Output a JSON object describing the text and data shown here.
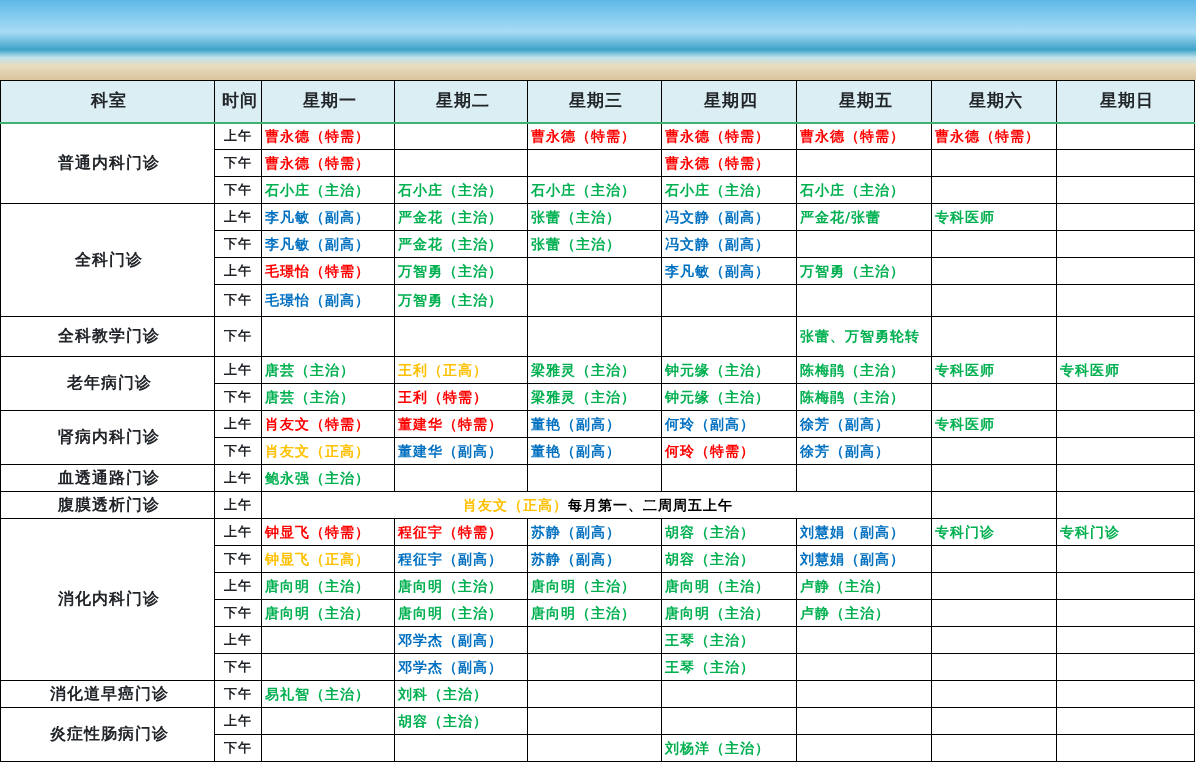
{
  "header": {
    "department": "科室",
    "time": "时间",
    "days": [
      "星期一",
      "星期二",
      "星期三",
      "星期四",
      "星期五",
      "星期六",
      "星期日"
    ]
  },
  "departments": [
    {
      "name": "普通内科门诊",
      "slots": [
        {
          "time": "上午",
          "cells": [
            {
              "text": "曹永德（特需）",
              "color": "#ff0000"
            },
            null,
            {
              "text": "曹永德（特需）",
              "color": "#ff0000"
            },
            {
              "text": "曹永德（特需）",
              "color": "#ff0000"
            },
            {
              "text": "曹永德（特需）",
              "color": "#ff0000"
            },
            {
              "text": "曹永德（特需）",
              "color": "#ff0000"
            },
            null
          ]
        },
        {
          "time": "下午",
          "cells": [
            {
              "text": "曹永德（特需）",
              "color": "#ff0000"
            },
            null,
            null,
            {
              "text": "曹永德（特需）",
              "color": "#ff0000"
            },
            null,
            null,
            null
          ]
        },
        {
          "time": "下午",
          "cells": [
            {
              "text": "石小庄（主治）",
              "color": "#00b050"
            },
            {
              "text": "石小庄（主治）",
              "color": "#00b050"
            },
            {
              "text": "石小庄（主治）",
              "color": "#00b050"
            },
            {
              "text": "石小庄（主治）",
              "color": "#00b050"
            },
            {
              "text": "石小庄（主治）",
              "color": "#00b050"
            },
            null,
            null
          ]
        }
      ]
    },
    {
      "name": "全科门诊",
      "slots": [
        {
          "time": "上午",
          "cells": [
            {
              "text": "李凡敏（副高）",
              "color": "#0070c0"
            },
            {
              "text": "严金花（主治）",
              "color": "#00b050"
            },
            {
              "text": "张蕾（主治）",
              "color": "#00b050"
            },
            {
              "text": "冯文静（副高）",
              "color": "#0070c0"
            },
            {
              "text": "严金花/张蕾",
              "color": "#00b050"
            },
            {
              "text": "专科医师",
              "color": "#00b050"
            },
            null
          ]
        },
        {
          "time": "下午",
          "cells": [
            {
              "text": "李凡敏（副高）",
              "color": "#0070c0"
            },
            {
              "text": "严金花（主治）",
              "color": "#00b050"
            },
            {
              "text": "张蕾（主治）",
              "color": "#00b050"
            },
            {
              "text": "冯文静（副高）",
              "color": "#0070c0"
            },
            null,
            null,
            null
          ]
        },
        {
          "time": "上午",
          "cells": [
            {
              "text": "毛璟怡（特需）",
              "color": "#ff0000"
            },
            {
              "text": "万智勇（主治）",
              "color": "#00b050"
            },
            null,
            {
              "text": "李凡敏（副高）",
              "color": "#0070c0"
            },
            {
              "text": "万智勇（主治）",
              "color": "#00b050"
            },
            null,
            null
          ]
        },
        {
          "time": "下午",
          "cells": [
            {
              "text": "毛璟怡（副高）",
              "color": "#0070c0"
            },
            {
              "text": "万智勇（主治）",
              "color": "#00b050"
            },
            null,
            null,
            null,
            null,
            null
          ]
        }
      ]
    },
    {
      "name": "全科教学门诊",
      "slots": [
        {
          "time": "下午",
          "cells": [
            null,
            null,
            null,
            null,
            {
              "text": "张蕾、万智勇轮转",
              "color": "#00b050"
            },
            null,
            null
          ]
        }
      ]
    },
    {
      "name": "老年病门诊",
      "slots": [
        {
          "time": "上午",
          "cells": [
            {
              "text": "唐芸（主治）",
              "color": "#00b050"
            },
            {
              "text": "王利（正高）",
              "color": "#ffc000"
            },
            {
              "text": "梁雅灵（主治）",
              "color": "#00b050"
            },
            {
              "text": "钟元缘（主治）",
              "color": "#00b050"
            },
            {
              "text": "陈梅鹃（主治）",
              "color": "#00b050"
            },
            {
              "text": "专科医师",
              "color": "#00b050"
            },
            {
              "text": "专科医师",
              "color": "#00b050"
            }
          ]
        },
        {
          "time": "下午",
          "cells": [
            {
              "text": "唐芸（主治）",
              "color": "#00b050"
            },
            {
              "text": "王利（特需）",
              "color": "#ff0000"
            },
            {
              "text": "梁雅灵（主治）",
              "color": "#00b050"
            },
            {
              "text": "钟元缘（主治）",
              "color": "#00b050"
            },
            {
              "text": "陈梅鹃（主治）",
              "color": "#00b050"
            },
            null,
            null
          ]
        }
      ]
    },
    {
      "name": "肾病内科门诊",
      "slots": [
        {
          "time": "上午",
          "cells": [
            {
              "text": "肖友文（特需）",
              "color": "#ff0000"
            },
            {
              "text": "董建华（特需）",
              "color": "#ff0000"
            },
            {
              "text": "董艳（副高）",
              "color": "#0070c0"
            },
            {
              "text": "何玲（副高）",
              "color": "#0070c0"
            },
            {
              "text": "徐芳（副高）",
              "color": "#0070c0"
            },
            {
              "text": "专科医师",
              "color": "#00b050"
            },
            null
          ]
        },
        {
          "time": "下午",
          "cells": [
            {
              "text": "肖友文（正高）",
              "color": "#ffc000"
            },
            {
              "text": "董建华（副高）",
              "color": "#0070c0"
            },
            {
              "text": "董艳（副高）",
              "color": "#0070c0"
            },
            {
              "text": "何玲（特需）",
              "color": "#ff0000"
            },
            {
              "text": "徐芳（副高）",
              "color": "#0070c0"
            },
            null,
            null
          ]
        }
      ]
    },
    {
      "name": "血透通路门诊",
      "slots": [
        {
          "time": "上午",
          "cells": [
            {
              "text": "鲍永强（主治）",
              "color": "#00b050"
            },
            null,
            null,
            null,
            null,
            null,
            null
          ]
        }
      ]
    },
    {
      "name": "腹膜透析门诊",
      "slots": [
        {
          "time": "上午",
          "note": [
            {
              "text": "肖友文（正高）",
              "color": "#ffc000"
            },
            {
              "text": "每月第一、二周周五上午",
              "color": "#000000"
            }
          ],
          "cells": [
            null,
            null
          ]
        }
      ]
    },
    {
      "name": "消化内科门诊",
      "slots": [
        {
          "time": "上午",
          "cells": [
            {
              "text": "钟显飞（特需）",
              "color": "#ff0000"
            },
            {
              "text": "程征宇（特需）",
              "color": "#ff0000"
            },
            {
              "text": "苏静（副高）",
              "color": "#0070c0"
            },
            {
              "text": "胡容（主治）",
              "color": "#00b050"
            },
            {
              "text": "刘慧娟（副高）",
              "color": "#0070c0"
            },
            {
              "text": "专科门诊",
              "color": "#00b050"
            },
            {
              "text": "专科门诊",
              "color": "#00b050"
            }
          ]
        },
        {
          "time": "下午",
          "cells": [
            {
              "text": "钟显飞（正高）",
              "color": "#ffc000"
            },
            {
              "text": "程征宇（副高）",
              "color": "#0070c0"
            },
            {
              "text": "苏静（副高）",
              "color": "#0070c0"
            },
            {
              "text": "胡容（主治）",
              "color": "#00b050"
            },
            {
              "text": "刘慧娟（副高）",
              "color": "#0070c0"
            },
            null,
            null
          ]
        },
        {
          "time": "上午",
          "cells": [
            {
              "text": "唐向明（主治）",
              "color": "#00b050"
            },
            {
              "text": "唐向明（主治）",
              "color": "#00b050"
            },
            {
              "text": "唐向明（主治）",
              "color": "#00b050"
            },
            {
              "text": "唐向明（主治）",
              "color": "#00b050"
            },
            {
              "text": "卢静（主治）",
              "color": "#00b050"
            },
            null,
            null
          ]
        },
        {
          "time": "下午",
          "cells": [
            {
              "text": "唐向明（主治）",
              "color": "#00b050"
            },
            {
              "text": "唐向明（主治）",
              "color": "#00b050"
            },
            {
              "text": "唐向明（主治）",
              "color": "#00b050"
            },
            {
              "text": "唐向明（主治）",
              "color": "#00b050"
            },
            {
              "text": "卢静（主治）",
              "color": "#00b050"
            },
            null,
            null
          ]
        },
        {
          "time": "上午",
          "cells": [
            null,
            {
              "text": "邓学杰（副高）",
              "color": "#0070c0"
            },
            null,
            {
              "text": "王琴（主治）",
              "color": "#00b050"
            },
            null,
            null,
            null
          ]
        },
        {
          "time": "下午",
          "cells": [
            null,
            {
              "text": "邓学杰（副高）",
              "color": "#0070c0"
            },
            null,
            {
              "text": "王琴（主治）",
              "color": "#00b050"
            },
            null,
            null,
            null
          ]
        }
      ]
    },
    {
      "name": "消化道早癌门诊",
      "slots": [
        {
          "time": "下午",
          "cells": [
            {
              "text": "易礼智（主治）",
              "color": "#00b050"
            },
            {
              "text": "刘科（主治）",
              "color": "#00b050"
            },
            null,
            null,
            null,
            null,
            null
          ]
        }
      ]
    },
    {
      "name": "炎症性肠病门诊",
      "slots": [
        {
          "time": "上午",
          "cells": [
            null,
            {
              "text": "胡容（主治）",
              "color": "#00b050"
            },
            null,
            null,
            null,
            null,
            null
          ]
        },
        {
          "time": "下午",
          "cells": [
            null,
            null,
            null,
            {
              "text": "刘杨洋（主治）",
              "color": "#00b050"
            },
            null,
            null,
            null
          ]
        }
      ]
    }
  ]
}
